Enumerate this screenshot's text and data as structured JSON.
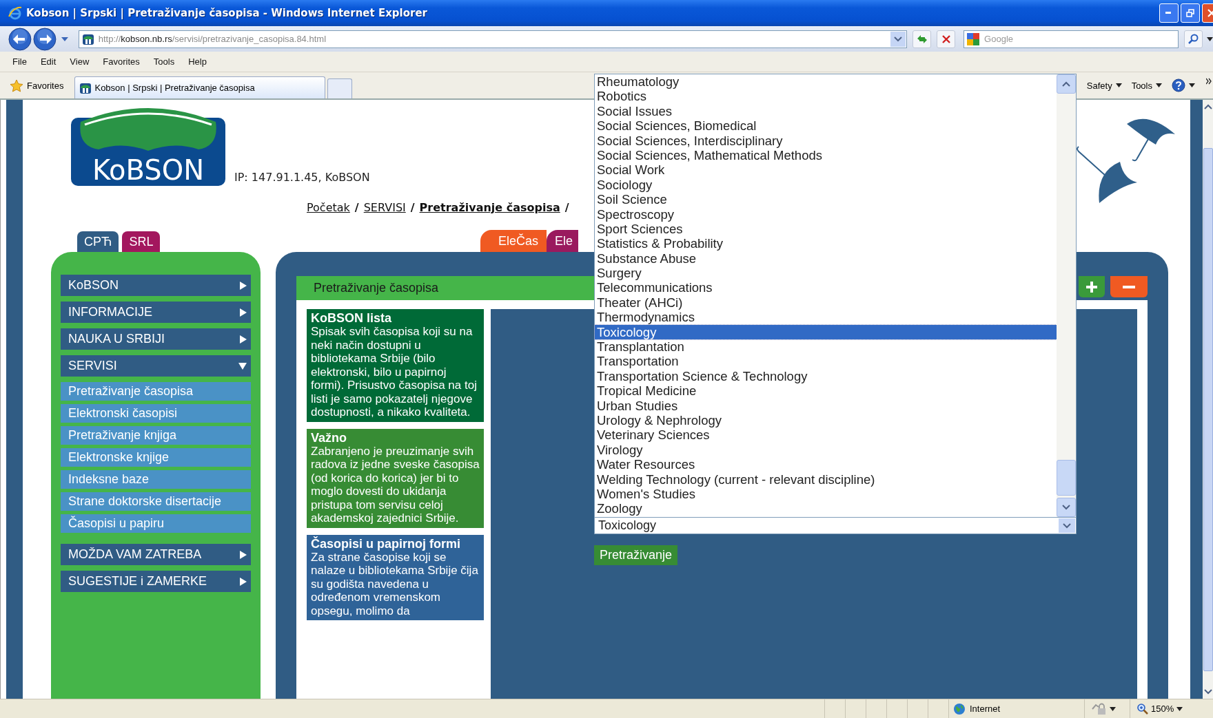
{
  "window": {
    "title": "Kobson | Srpski | Pretraživanje časopisa - Windows Internet Explorer"
  },
  "address_bar": {
    "url_scheme": "http://",
    "url_host": "kobson.nb.rs",
    "url_path": "/servisi/pretrazivanje_casopisa.84.html"
  },
  "search": {
    "placeholder": "Google"
  },
  "menu": [
    "File",
    "Edit",
    "View",
    "Favorites",
    "Tools",
    "Help"
  ],
  "favorites_bar": {
    "label": "Favorites",
    "tabs": [
      {
        "title": "Kobson | Srpski | Pretraživanje časopisa",
        "selected": true
      }
    ]
  },
  "command_bar": [
    "Safety",
    "Tools"
  ],
  "header": {
    "logo": "KoBSON",
    "ip": "IP: 147.91.1.45, KoBSON",
    "separator": "/",
    "breadcrumb": [
      {
        "label": "Početak",
        "current": false
      },
      {
        "label": "SERVISI",
        "current": false
      },
      {
        "label": "Pretraživanje časopisa",
        "current": true
      }
    ]
  },
  "script_tabs": [
    {
      "label": "CPЋ",
      "color": "#305c84"
    },
    {
      "label": "SRL",
      "color": "#a3175e"
    }
  ],
  "service_tabs": [
    {
      "label": "EleČas",
      "color": "#f05a22"
    },
    {
      "label": "Ele",
      "color": "#9a1a5e"
    }
  ],
  "sidebar": {
    "items": [
      {
        "label": "KoBSON",
        "expanded": false
      },
      {
        "label": "INFORMACIJE",
        "expanded": false
      },
      {
        "label": "NAUKA U SRBIJI",
        "expanded": false
      },
      {
        "label": "SERVISI",
        "expanded": true,
        "children": [
          {
            "label": "Pretraživanje časopisa"
          },
          {
            "label": "Elektronski časopisi"
          },
          {
            "label": "Pretraživanje knjiga"
          },
          {
            "label": "Elektronske knjige"
          },
          {
            "label": "Indeksne baze"
          },
          {
            "label": "Strane doktorske disertacije"
          },
          {
            "label": "Časopisi u papiru"
          }
        ]
      },
      {
        "label": "MOŽDA VAM ZATREBA",
        "expanded": false
      },
      {
        "label": "SUGESTIJE i ZAMERKE",
        "expanded": false
      }
    ]
  },
  "panel": {
    "title": "Pretraživanje časopisa",
    "boxes": [
      {
        "title": "KoBSON lista",
        "text": "Spisak svih časopisa koji su na neki način dostupni u bibliotekama Srbije (bilo elektronski, bilo u papirnoj formi). Prisustvo časopisa na toj listi je samo pokazatelj njegove dostupnosti, a nikako kvaliteta.",
        "color": "#006a37"
      },
      {
        "title": "Važno",
        "text": "Zabranjeno je preuzimanje svih radova iz jedne sveske časopisa (od korica do korica) jer bi to moglo dovesti do ukidanja pristupa tom servisu celoj akademskoj zajednici Srbije.",
        "color": "#378c34"
      },
      {
        "title": "Časopisi u papirnoj formi",
        "text": "Za strane časopise koji se nalaze u bibliotekama Srbije čija su godišta navedena u određenom vremenskom opsegu, molimo da",
        "color": "#2f6398"
      }
    ],
    "select_value": "Toxicology",
    "options": [
      {
        "label": "Rheumatology",
        "selected": false
      },
      {
        "label": "Robotics",
        "selected": false
      },
      {
        "label": "Social Issues",
        "selected": false
      },
      {
        "label": "Social Sciences, Biomedical",
        "selected": false
      },
      {
        "label": "Social Sciences, Interdisciplinary",
        "selected": false
      },
      {
        "label": "Social Sciences, Mathematical Methods",
        "selected": false
      },
      {
        "label": "Social Work",
        "selected": false
      },
      {
        "label": "Sociology",
        "selected": false
      },
      {
        "label": "Soil Science",
        "selected": false
      },
      {
        "label": "Spectroscopy",
        "selected": false
      },
      {
        "label": "Sport Sciences",
        "selected": false
      },
      {
        "label": "Statistics & Probability",
        "selected": false
      },
      {
        "label": "Substance Abuse",
        "selected": false
      },
      {
        "label": "Surgery",
        "selected": false
      },
      {
        "label": "Telecommunications",
        "selected": false
      },
      {
        "label": "Theater (AHCi)",
        "selected": false
      },
      {
        "label": "Thermodynamics",
        "selected": false
      },
      {
        "label": "Toxicology",
        "selected": true
      },
      {
        "label": "Transplantation",
        "selected": false
      },
      {
        "label": "Transportation",
        "selected": false
      },
      {
        "label": "Transportation Science & Technology",
        "selected": false
      },
      {
        "label": "Tropical Medicine",
        "selected": false
      },
      {
        "label": "Urban Studies",
        "selected": false
      },
      {
        "label": "Urology & Nephrology",
        "selected": false
      },
      {
        "label": "Veterinary Sciences",
        "selected": false
      },
      {
        "label": "Virology",
        "selected": false
      },
      {
        "label": "Water Resources",
        "selected": false
      },
      {
        "label": "Welding Technology (current - relevant discipline)",
        "selected": false
      },
      {
        "label": "Women's Studies",
        "selected": false
      },
      {
        "label": "Zoology",
        "selected": false
      }
    ],
    "button": "Pretraživanje"
  },
  "status_bar": {
    "zone": "Internet",
    "zoom": "150%"
  }
}
